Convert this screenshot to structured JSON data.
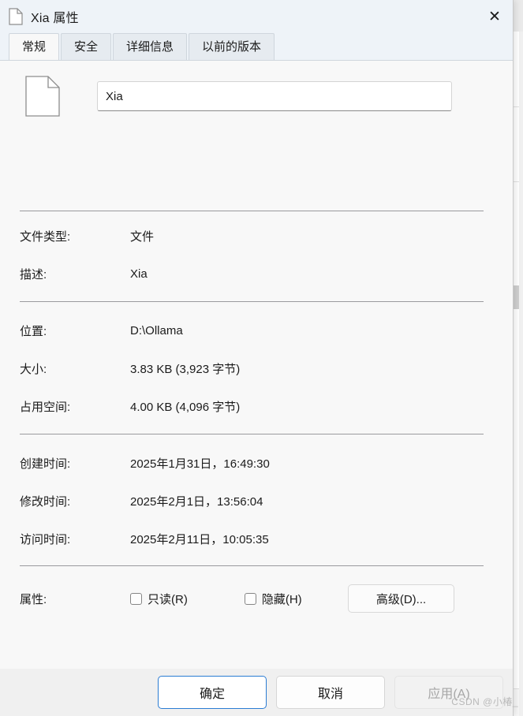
{
  "window": {
    "title": "Xia 属性",
    "icon": "document-icon",
    "close_label": "✕"
  },
  "tabs": [
    {
      "label": "常规",
      "active": true
    },
    {
      "label": "安全",
      "active": false
    },
    {
      "label": "详细信息",
      "active": false
    },
    {
      "label": "以前的版本",
      "active": false
    }
  ],
  "general": {
    "file_icon": "blank-document-icon",
    "filename_value": "Xia",
    "filename_placeholder": "",
    "rows": [
      {
        "label": "文件类型:",
        "value": "文件"
      },
      {
        "label": "描述:",
        "value": "Xia"
      },
      {
        "label": "位置:",
        "value": "D:\\Ollama"
      },
      {
        "label": "大小:",
        "value": "3.83 KB (3,923 字节)"
      },
      {
        "label": "占用空间:",
        "value": "4.00 KB (4,096 字节)"
      },
      {
        "label": "创建时间:",
        "value": "2025年1月31日，16:49:30"
      },
      {
        "label": "修改时间:",
        "value": "2025年2月1日，13:56:04"
      },
      {
        "label": "访问时间:",
        "value": "2025年2月11日，10:05:35"
      }
    ],
    "attributes": {
      "label": "属性:",
      "readonly_label": "只读(R)",
      "readonly_checked": false,
      "hidden_label": "隐藏(H)",
      "hidden_checked": false,
      "advanced_label": "高级(D)..."
    }
  },
  "footer": {
    "ok_label": "确定",
    "cancel_label": "取消",
    "apply_label": "应用(A)",
    "apply_disabled": true
  },
  "watermark": "CSDN @小椿_",
  "background": {
    "cells": [
      "B",
      "B",
      "B",
      "B"
    ]
  },
  "colors": {
    "titlebar_bg": "#eef3f8",
    "content_bg": "#f8f8f8",
    "accent": "#2b7cd3",
    "separator": "#9a9a9e",
    "text": "#1b1b1b",
    "disabled_text": "#a6a6a6"
  }
}
